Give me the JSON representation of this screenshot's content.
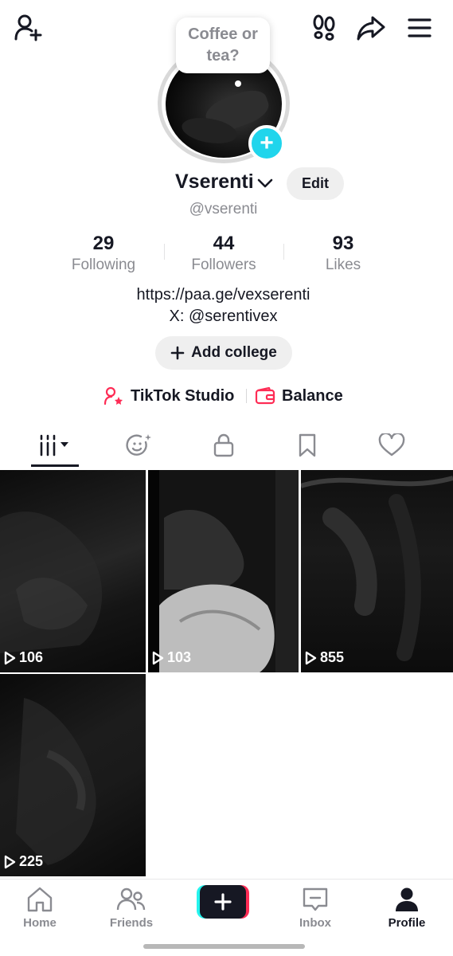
{
  "header": {
    "add_friend_icon": "person-plus-icon",
    "footprints_icon": "footprints-icon",
    "share_icon": "share-arrow-icon",
    "menu_icon": "hamburger-menu-icon"
  },
  "profile": {
    "note_bubble": "Coffee or tea?",
    "display_name": "Vserenti",
    "edit_label": "Edit",
    "handle": "@vserenti",
    "avatar_plus": "+"
  },
  "stats": [
    {
      "value": "29",
      "label": "Following"
    },
    {
      "value": "44",
      "label": "Followers"
    },
    {
      "value": "93",
      "label": "Likes"
    }
  ],
  "bio": {
    "line1": "https://paa.ge/vexserenti",
    "line2": "X: @serentivex"
  },
  "add_college_label": "Add college",
  "tools": {
    "studio_label": "TikTok Studio",
    "balance_label": "Balance",
    "accent_color": "#fe2c55"
  },
  "tabs": [
    {
      "name": "videos",
      "icon": "grid-bars-icon",
      "active": true
    },
    {
      "name": "reposts",
      "icon": "face-sparkle-icon"
    },
    {
      "name": "private",
      "icon": "lock-icon"
    },
    {
      "name": "favorites",
      "icon": "bookmark-icon"
    },
    {
      "name": "liked",
      "icon": "heart-icon"
    }
  ],
  "videos": [
    {
      "views": "106"
    },
    {
      "views": "103"
    },
    {
      "views": "855"
    },
    {
      "views": "225"
    }
  ],
  "bottom_nav": [
    {
      "label": "Home",
      "icon": "home-icon"
    },
    {
      "label": "Friends",
      "icon": "friends-icon"
    },
    {
      "label": "",
      "icon": "create-plus-icon"
    },
    {
      "label": "Inbox",
      "icon": "inbox-icon"
    },
    {
      "label": "Profile",
      "icon": "profile-icon",
      "active": true
    }
  ]
}
